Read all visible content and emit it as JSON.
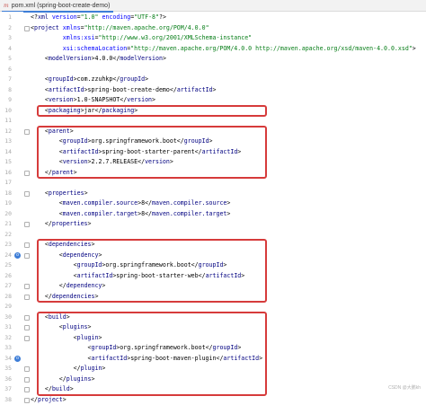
{
  "tab": {
    "icon": "maven-icon",
    "title": "pom.xml (spring-boot-create-demo)"
  },
  "lines": [
    {
      "n": "1",
      "segs": [
        [
          "t",
          "<?"
        ],
        [
          "g",
          "xml"
        ],
        [
          "a",
          " version"
        ],
        [
          "t",
          "="
        ],
        [
          "v",
          "\"1.0\""
        ],
        [
          "a",
          " encoding"
        ],
        [
          "t",
          "="
        ],
        [
          "v",
          "\"UTF-8\""
        ],
        [
          "t",
          "?>"
        ]
      ]
    },
    {
      "n": "2",
      "segs": [
        [
          "t",
          "<"
        ],
        [
          "g",
          "project"
        ],
        [
          "a",
          " xmlns"
        ],
        [
          "t",
          "="
        ],
        [
          "v",
          "\"http://maven.apache.org/POM/4.0.0\""
        ]
      ]
    },
    {
      "n": "3",
      "segs": [
        [
          "a",
          "         xmlns:xsi"
        ],
        [
          "t",
          "="
        ],
        [
          "v",
          "\"http://www.w3.org/2001/XMLSchema-instance\""
        ]
      ]
    },
    {
      "n": "4",
      "segs": [
        [
          "a",
          "         xsi:schemaLocation"
        ],
        [
          "t",
          "="
        ],
        [
          "v",
          "\"http://maven.apache.org/POM/4.0.0 http://maven.apache.org/xsd/maven-4.0.0.xsd\""
        ],
        [
          "t",
          ">"
        ]
      ]
    },
    {
      "n": "5",
      "segs": [
        [
          "t",
          "    <"
        ],
        [
          "g",
          "modelVersion"
        ],
        [
          "t",
          ">"
        ],
        [
          "x",
          "4.0.0"
        ],
        [
          "t",
          "</"
        ],
        [
          "g",
          "modelVersion"
        ],
        [
          "t",
          ">"
        ]
      ]
    },
    {
      "n": "6",
      "segs": []
    },
    {
      "n": "7",
      "segs": [
        [
          "t",
          "    <"
        ],
        [
          "g",
          "groupId"
        ],
        [
          "t",
          ">"
        ],
        [
          "x",
          "com.zzuhkp"
        ],
        [
          "t",
          "</"
        ],
        [
          "g",
          "groupId"
        ],
        [
          "t",
          ">"
        ]
      ]
    },
    {
      "n": "8",
      "segs": [
        [
          "t",
          "    <"
        ],
        [
          "g",
          "artifactId"
        ],
        [
          "t",
          ">"
        ],
        [
          "x",
          "spring-boot-create-demo"
        ],
        [
          "t",
          "</"
        ],
        [
          "g",
          "artifactId"
        ],
        [
          "t",
          ">"
        ]
      ]
    },
    {
      "n": "9",
      "segs": [
        [
          "t",
          "    <"
        ],
        [
          "g",
          "version"
        ],
        [
          "t",
          ">"
        ],
        [
          "x",
          "1.0-SNAPSHOT"
        ],
        [
          "t",
          "</"
        ],
        [
          "g",
          "version"
        ],
        [
          "t",
          ">"
        ]
      ]
    },
    {
      "n": "10",
      "segs": [
        [
          "t",
          "    <"
        ],
        [
          "g",
          "packaging"
        ],
        [
          "t",
          ">"
        ],
        [
          "x",
          "jar"
        ],
        [
          "t",
          "</"
        ],
        [
          "g",
          "packaging"
        ],
        [
          "t",
          ">"
        ]
      ]
    },
    {
      "n": "11",
      "segs": []
    },
    {
      "n": "12",
      "segs": [
        [
          "t",
          "    <"
        ],
        [
          "g",
          "parent"
        ],
        [
          "t",
          ">"
        ]
      ]
    },
    {
      "n": "13",
      "segs": [
        [
          "t",
          "        <"
        ],
        [
          "g",
          "groupId"
        ],
        [
          "t",
          ">"
        ],
        [
          "x",
          "org.springframework.boot"
        ],
        [
          "t",
          "</"
        ],
        [
          "g",
          "groupId"
        ],
        [
          "t",
          ">"
        ]
      ]
    },
    {
      "n": "14",
      "segs": [
        [
          "t",
          "        <"
        ],
        [
          "g",
          "artifactId"
        ],
        [
          "t",
          ">"
        ],
        [
          "x",
          "spring-boot-starter-parent"
        ],
        [
          "t",
          "</"
        ],
        [
          "g",
          "artifactId"
        ],
        [
          "t",
          ">"
        ]
      ]
    },
    {
      "n": "15",
      "segs": [
        [
          "t",
          "        <"
        ],
        [
          "g",
          "version"
        ],
        [
          "t",
          ">"
        ],
        [
          "x",
          "2.2.7.RELEASE"
        ],
        [
          "t",
          "</"
        ],
        [
          "g",
          "version"
        ],
        [
          "t",
          ">"
        ]
      ]
    },
    {
      "n": "16",
      "segs": [
        [
          "t",
          "    </"
        ],
        [
          "g",
          "parent"
        ],
        [
          "t",
          ">"
        ]
      ]
    },
    {
      "n": "17",
      "segs": []
    },
    {
      "n": "18",
      "segs": [
        [
          "t",
          "    <"
        ],
        [
          "g",
          "properties"
        ],
        [
          "t",
          ">"
        ]
      ]
    },
    {
      "n": "19",
      "segs": [
        [
          "t",
          "        <"
        ],
        [
          "g",
          "maven.compiler.source"
        ],
        [
          "t",
          ">"
        ],
        [
          "x",
          "8"
        ],
        [
          "t",
          "</"
        ],
        [
          "g",
          "maven.compiler.source"
        ],
        [
          "t",
          ">"
        ]
      ]
    },
    {
      "n": "20",
      "segs": [
        [
          "t",
          "        <"
        ],
        [
          "g",
          "maven.compiler.target"
        ],
        [
          "t",
          ">"
        ],
        [
          "x",
          "8"
        ],
        [
          "t",
          "</"
        ],
        [
          "g",
          "maven.compiler.target"
        ],
        [
          "t",
          ">"
        ]
      ]
    },
    {
      "n": "21",
      "segs": [
        [
          "t",
          "    </"
        ],
        [
          "g",
          "properties"
        ],
        [
          "t",
          ">"
        ]
      ]
    },
    {
      "n": "22",
      "segs": []
    },
    {
      "n": "23",
      "segs": [
        [
          "t",
          "    <"
        ],
        [
          "g",
          "dependencies"
        ],
        [
          "t",
          ">"
        ]
      ]
    },
    {
      "n": "24",
      "segs": [
        [
          "t",
          "        <"
        ],
        [
          "g",
          "dependency"
        ],
        [
          "t",
          ">"
        ]
      ]
    },
    {
      "n": "25",
      "segs": [
        [
          "t",
          "            <"
        ],
        [
          "g",
          "groupId"
        ],
        [
          "t",
          ">"
        ],
        [
          "x",
          "org.springframework.boot"
        ],
        [
          "t",
          "</"
        ],
        [
          "g",
          "groupId"
        ],
        [
          "t",
          ">"
        ]
      ]
    },
    {
      "n": "26",
      "segs": [
        [
          "t",
          "            <"
        ],
        [
          "g",
          "artifactId"
        ],
        [
          "t",
          ">"
        ],
        [
          "x",
          "spring-boot-starter-web"
        ],
        [
          "t",
          "</"
        ],
        [
          "g",
          "artifactId"
        ],
        [
          "t",
          ">"
        ]
      ]
    },
    {
      "n": "27",
      "segs": [
        [
          "t",
          "        </"
        ],
        [
          "g",
          "dependency"
        ],
        [
          "t",
          ">"
        ]
      ]
    },
    {
      "n": "28",
      "segs": [
        [
          "t",
          "    </"
        ],
        [
          "g",
          "dependencies"
        ],
        [
          "t",
          ">"
        ]
      ]
    },
    {
      "n": "29",
      "segs": []
    },
    {
      "n": "30",
      "segs": [
        [
          "t",
          "    <"
        ],
        [
          "g",
          "build"
        ],
        [
          "t",
          ">"
        ]
      ]
    },
    {
      "n": "31",
      "segs": [
        [
          "t",
          "        <"
        ],
        [
          "g",
          "plugins"
        ],
        [
          "t",
          ">"
        ]
      ]
    },
    {
      "n": "32",
      "segs": [
        [
          "t",
          "            <"
        ],
        [
          "g",
          "plugin"
        ],
        [
          "t",
          ">"
        ]
      ]
    },
    {
      "n": "33",
      "segs": [
        [
          "t",
          "                <"
        ],
        [
          "g",
          "groupId"
        ],
        [
          "t",
          ">"
        ],
        [
          "x",
          "org.springframework.boot"
        ],
        [
          "t",
          "</"
        ],
        [
          "g",
          "groupId"
        ],
        [
          "t",
          ">"
        ]
      ]
    },
    {
      "n": "34",
      "segs": [
        [
          "t",
          "                <"
        ],
        [
          "g",
          "artifactId"
        ],
        [
          "t",
          ">"
        ],
        [
          "x",
          "spring-boot-maven-plugin"
        ],
        [
          "t",
          "</"
        ],
        [
          "g",
          "artifactId"
        ],
        [
          "t",
          ">"
        ]
      ]
    },
    {
      "n": "35",
      "segs": [
        [
          "t",
          "            </"
        ],
        [
          "g",
          "plugin"
        ],
        [
          "t",
          ">"
        ]
      ]
    },
    {
      "n": "36",
      "segs": [
        [
          "t",
          "        </"
        ],
        [
          "g",
          "plugins"
        ],
        [
          "t",
          ">"
        ]
      ]
    },
    {
      "n": "37",
      "segs": [
        [
          "t",
          "    </"
        ],
        [
          "g",
          "build"
        ],
        [
          "t",
          ">"
        ]
      ]
    },
    {
      "n": "38",
      "segs": [
        [
          "t",
          "</"
        ],
        [
          "g",
          "project"
        ],
        [
          "t",
          ">"
        ]
      ]
    }
  ],
  "gutter_marks": [
    {
      "line": "24",
      "icon": "dependency-run-icon"
    },
    {
      "line": "34",
      "icon": "dependency-run-icon"
    }
  ],
  "highlights": [
    {
      "name": "packaging-highlight",
      "from": "10",
      "to": "10"
    },
    {
      "name": "parent-highlight",
      "from": "12",
      "to": "16"
    },
    {
      "name": "dependencies-highlight",
      "from": "23",
      "to": "28"
    },
    {
      "name": "build-highlight",
      "from": "30",
      "to": "37"
    }
  ],
  "colors": {
    "tag": "#000080",
    "attr": "#0000ff",
    "value": "#067d17",
    "text": "#000000",
    "highlight": "#d63b3b"
  },
  "watermark": "CSDN @大鹏kh"
}
